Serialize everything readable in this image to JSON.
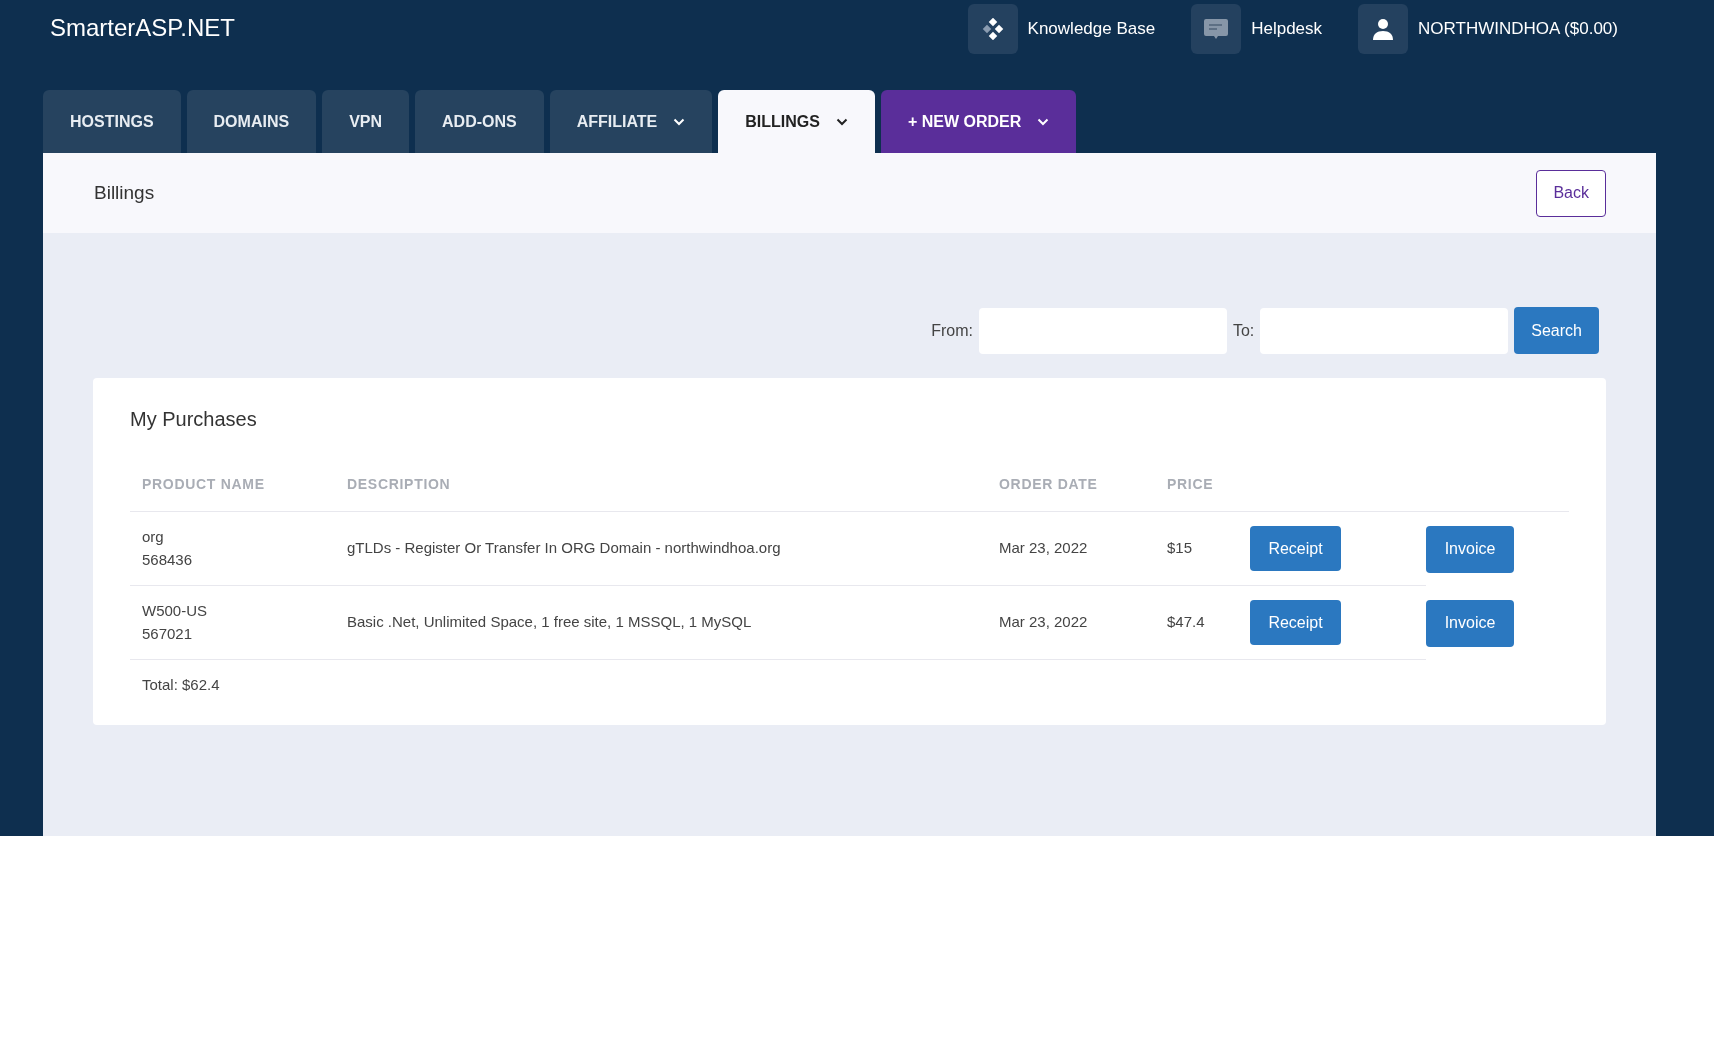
{
  "brand": "SmarterASP.NET",
  "top_nav": [
    {
      "kind": "knowledge",
      "label": "Knowledge Base"
    },
    {
      "kind": "helpdesk",
      "label": "Helpdesk"
    },
    {
      "kind": "account",
      "label": "NORTHWINDHOA ($0.00)"
    }
  ],
  "tabs": [
    {
      "label": "HOSTINGS",
      "selected": false,
      "dropdown": false,
      "kind": "normal"
    },
    {
      "label": "DOMAINS",
      "selected": false,
      "dropdown": false,
      "kind": "normal"
    },
    {
      "label": "VPN",
      "selected": false,
      "dropdown": false,
      "kind": "normal"
    },
    {
      "label": "ADD-ONS",
      "selected": false,
      "dropdown": false,
      "kind": "normal"
    },
    {
      "label": "AFFILIATE",
      "selected": false,
      "dropdown": true,
      "kind": "normal"
    },
    {
      "label": "BILLINGS",
      "selected": true,
      "dropdown": true,
      "kind": "normal"
    },
    {
      "label": "+ NEW ORDER",
      "selected": false,
      "dropdown": true,
      "kind": "order"
    }
  ],
  "page_title": "Billings",
  "back_button": "Back",
  "filter": {
    "from_label": "From:",
    "to_label": "To:",
    "search_button": "Search"
  },
  "purchases": {
    "title": "My Purchases",
    "columns": [
      "PRODUCT NAME",
      "DESCRIPTION",
      "ORDER DATE",
      "PRICE"
    ],
    "rows": [
      {
        "product": "org",
        "id": "568436",
        "description": "gTLDs - Register Or Transfer In ORG Domain - northwindhoa.org",
        "date": "Mar 23, 2022",
        "price": "$15",
        "receipt": "Receipt",
        "invoice": "Invoice"
      },
      {
        "product": "W500-US",
        "id": "567021",
        "description": "Basic .Net, Unlimited Space, 1 free site, 1 MSSQL, 1 MySQL",
        "date": "Mar 23, 2022",
        "price": "$47.4",
        "receipt": "Receipt",
        "invoice": "Invoice"
      }
    ],
    "total": "Total: $62.4"
  }
}
